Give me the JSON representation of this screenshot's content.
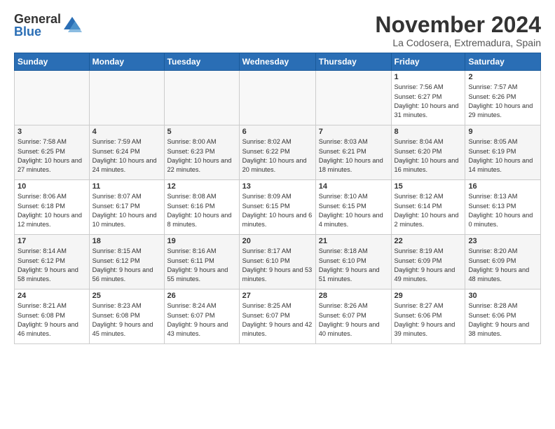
{
  "header": {
    "logo_general": "General",
    "logo_blue": "Blue",
    "month_title": "November 2024",
    "location": "La Codosera, Extremadura, Spain"
  },
  "weekdays": [
    "Sunday",
    "Monday",
    "Tuesday",
    "Wednesday",
    "Thursday",
    "Friday",
    "Saturday"
  ],
  "weeks": [
    [
      {
        "day": "",
        "info": ""
      },
      {
        "day": "",
        "info": ""
      },
      {
        "day": "",
        "info": ""
      },
      {
        "day": "",
        "info": ""
      },
      {
        "day": "",
        "info": ""
      },
      {
        "day": "1",
        "info": "Sunrise: 7:56 AM\nSunset: 6:27 PM\nDaylight: 10 hours\nand 31 minutes."
      },
      {
        "day": "2",
        "info": "Sunrise: 7:57 AM\nSunset: 6:26 PM\nDaylight: 10 hours\nand 29 minutes."
      }
    ],
    [
      {
        "day": "3",
        "info": "Sunrise: 7:58 AM\nSunset: 6:25 PM\nDaylight: 10 hours\nand 27 minutes."
      },
      {
        "day": "4",
        "info": "Sunrise: 7:59 AM\nSunset: 6:24 PM\nDaylight: 10 hours\nand 24 minutes."
      },
      {
        "day": "5",
        "info": "Sunrise: 8:00 AM\nSunset: 6:23 PM\nDaylight: 10 hours\nand 22 minutes."
      },
      {
        "day": "6",
        "info": "Sunrise: 8:02 AM\nSunset: 6:22 PM\nDaylight: 10 hours\nand 20 minutes."
      },
      {
        "day": "7",
        "info": "Sunrise: 8:03 AM\nSunset: 6:21 PM\nDaylight: 10 hours\nand 18 minutes."
      },
      {
        "day": "8",
        "info": "Sunrise: 8:04 AM\nSunset: 6:20 PM\nDaylight: 10 hours\nand 16 minutes."
      },
      {
        "day": "9",
        "info": "Sunrise: 8:05 AM\nSunset: 6:19 PM\nDaylight: 10 hours\nand 14 minutes."
      }
    ],
    [
      {
        "day": "10",
        "info": "Sunrise: 8:06 AM\nSunset: 6:18 PM\nDaylight: 10 hours\nand 12 minutes."
      },
      {
        "day": "11",
        "info": "Sunrise: 8:07 AM\nSunset: 6:17 PM\nDaylight: 10 hours\nand 10 minutes."
      },
      {
        "day": "12",
        "info": "Sunrise: 8:08 AM\nSunset: 6:16 PM\nDaylight: 10 hours\nand 8 minutes."
      },
      {
        "day": "13",
        "info": "Sunrise: 8:09 AM\nSunset: 6:15 PM\nDaylight: 10 hours\nand 6 minutes."
      },
      {
        "day": "14",
        "info": "Sunrise: 8:10 AM\nSunset: 6:15 PM\nDaylight: 10 hours\nand 4 minutes."
      },
      {
        "day": "15",
        "info": "Sunrise: 8:12 AM\nSunset: 6:14 PM\nDaylight: 10 hours\nand 2 minutes."
      },
      {
        "day": "16",
        "info": "Sunrise: 8:13 AM\nSunset: 6:13 PM\nDaylight: 10 hours\nand 0 minutes."
      }
    ],
    [
      {
        "day": "17",
        "info": "Sunrise: 8:14 AM\nSunset: 6:12 PM\nDaylight: 9 hours\nand 58 minutes."
      },
      {
        "day": "18",
        "info": "Sunrise: 8:15 AM\nSunset: 6:12 PM\nDaylight: 9 hours\nand 56 minutes."
      },
      {
        "day": "19",
        "info": "Sunrise: 8:16 AM\nSunset: 6:11 PM\nDaylight: 9 hours\nand 55 minutes."
      },
      {
        "day": "20",
        "info": "Sunrise: 8:17 AM\nSunset: 6:10 PM\nDaylight: 9 hours\nand 53 minutes."
      },
      {
        "day": "21",
        "info": "Sunrise: 8:18 AM\nSunset: 6:10 PM\nDaylight: 9 hours\nand 51 minutes."
      },
      {
        "day": "22",
        "info": "Sunrise: 8:19 AM\nSunset: 6:09 PM\nDaylight: 9 hours\nand 49 minutes."
      },
      {
        "day": "23",
        "info": "Sunrise: 8:20 AM\nSunset: 6:09 PM\nDaylight: 9 hours\nand 48 minutes."
      }
    ],
    [
      {
        "day": "24",
        "info": "Sunrise: 8:21 AM\nSunset: 6:08 PM\nDaylight: 9 hours\nand 46 minutes."
      },
      {
        "day": "25",
        "info": "Sunrise: 8:23 AM\nSunset: 6:08 PM\nDaylight: 9 hours\nand 45 minutes."
      },
      {
        "day": "26",
        "info": "Sunrise: 8:24 AM\nSunset: 6:07 PM\nDaylight: 9 hours\nand 43 minutes."
      },
      {
        "day": "27",
        "info": "Sunrise: 8:25 AM\nSunset: 6:07 PM\nDaylight: 9 hours\nand 42 minutes."
      },
      {
        "day": "28",
        "info": "Sunrise: 8:26 AM\nSunset: 6:07 PM\nDaylight: 9 hours\nand 40 minutes."
      },
      {
        "day": "29",
        "info": "Sunrise: 8:27 AM\nSunset: 6:06 PM\nDaylight: 9 hours\nand 39 minutes."
      },
      {
        "day": "30",
        "info": "Sunrise: 8:28 AM\nSunset: 6:06 PM\nDaylight: 9 hours\nand 38 minutes."
      }
    ]
  ]
}
